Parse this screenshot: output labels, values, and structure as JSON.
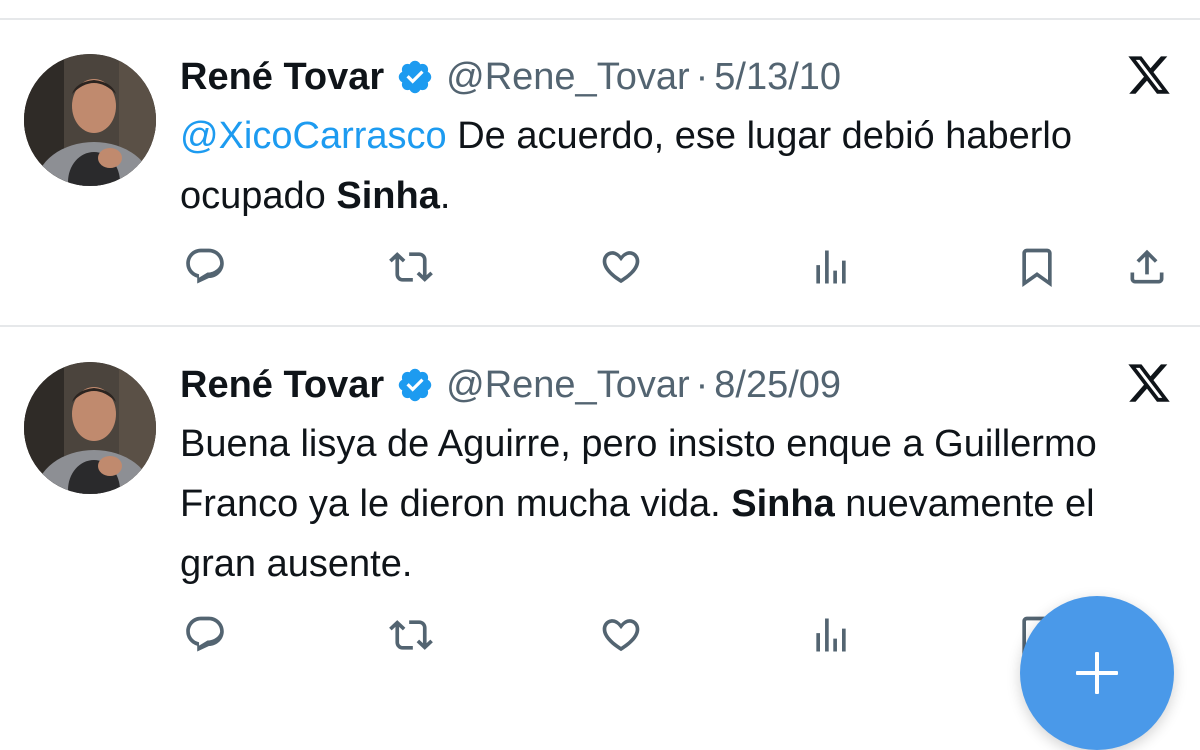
{
  "tweets": [
    {
      "author_name": "René Tovar",
      "handle": "@Rene_Tovar",
      "separator": "·",
      "date": "5/13/10",
      "mention": "@XicoCarrasco",
      "text_part1": " De acuerdo, ese lugar debió haberlo ocupado ",
      "bold_word": "Sinha",
      "text_part2": "."
    },
    {
      "author_name": "René Tovar",
      "handle": "@Rene_Tovar",
      "separator": "·",
      "date": "8/25/09",
      "text_part1": "Buena lisya de Aguirre, pero insisto enque a Guillermo Franco ya le dieron mucha vida. ",
      "bold_word": "Sinha",
      "text_part2": " nuevamente el gran ausente."
    }
  ],
  "icons": {
    "verified": "verified-badge-icon",
    "platform": "x-logo-icon",
    "reply": "reply-icon",
    "retweet": "retweet-icon",
    "like": "like-icon",
    "views": "views-icon",
    "bookmark": "bookmark-icon",
    "share": "share-icon",
    "compose": "plus-icon"
  },
  "colors": {
    "accent": "#1d9bf0",
    "fab": "#4a99e9",
    "secondary_text": "#536471",
    "icon": "#536471"
  }
}
